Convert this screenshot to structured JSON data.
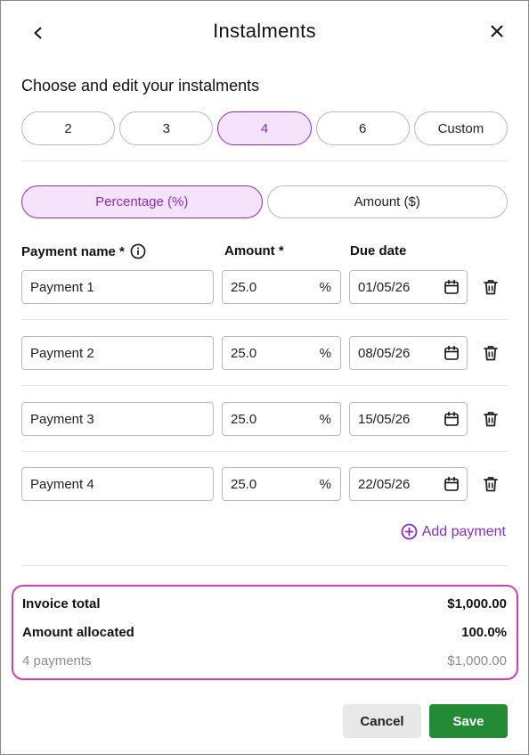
{
  "header": {
    "title": "Instalments",
    "back_icon": "chevron-left-icon",
    "close_icon": "close-icon"
  },
  "subtitle": "Choose and edit your instalments",
  "instalment_options": {
    "items": [
      "2",
      "3",
      "4",
      "6",
      "Custom"
    ],
    "selected": "4"
  },
  "mode_options": {
    "items": [
      "Percentage (%)",
      "Amount ($)"
    ],
    "selected": "Percentage (%)"
  },
  "columns": {
    "name": "Payment name *",
    "amount": "Amount *",
    "due": "Due date"
  },
  "payments": [
    {
      "name": "Payment 1",
      "amount": "25.0",
      "unit": "%",
      "due": "01/05/26"
    },
    {
      "name": "Payment 2",
      "amount": "25.0",
      "unit": "%",
      "due": "08/05/26"
    },
    {
      "name": "Payment 3",
      "amount": "25.0",
      "unit": "%",
      "due": "15/05/26"
    },
    {
      "name": "Payment 4",
      "amount": "25.0",
      "unit": "%",
      "due": "22/05/26"
    }
  ],
  "add_payment_label": "Add payment",
  "summary": {
    "invoice_total_label": "Invoice total",
    "invoice_total_value": "$1,000.00",
    "allocated_label": "Amount allocated",
    "allocated_value": "100.0%",
    "count_label": "4 payments",
    "count_value": "$1,000.00"
  },
  "footer": {
    "cancel_label": "Cancel",
    "save_label": "Save"
  },
  "colors": {
    "accent": "#8a2cc7",
    "accent_bg": "#f4e3fb",
    "highlight_border": "#d63bb8",
    "save_green": "#238a36"
  }
}
